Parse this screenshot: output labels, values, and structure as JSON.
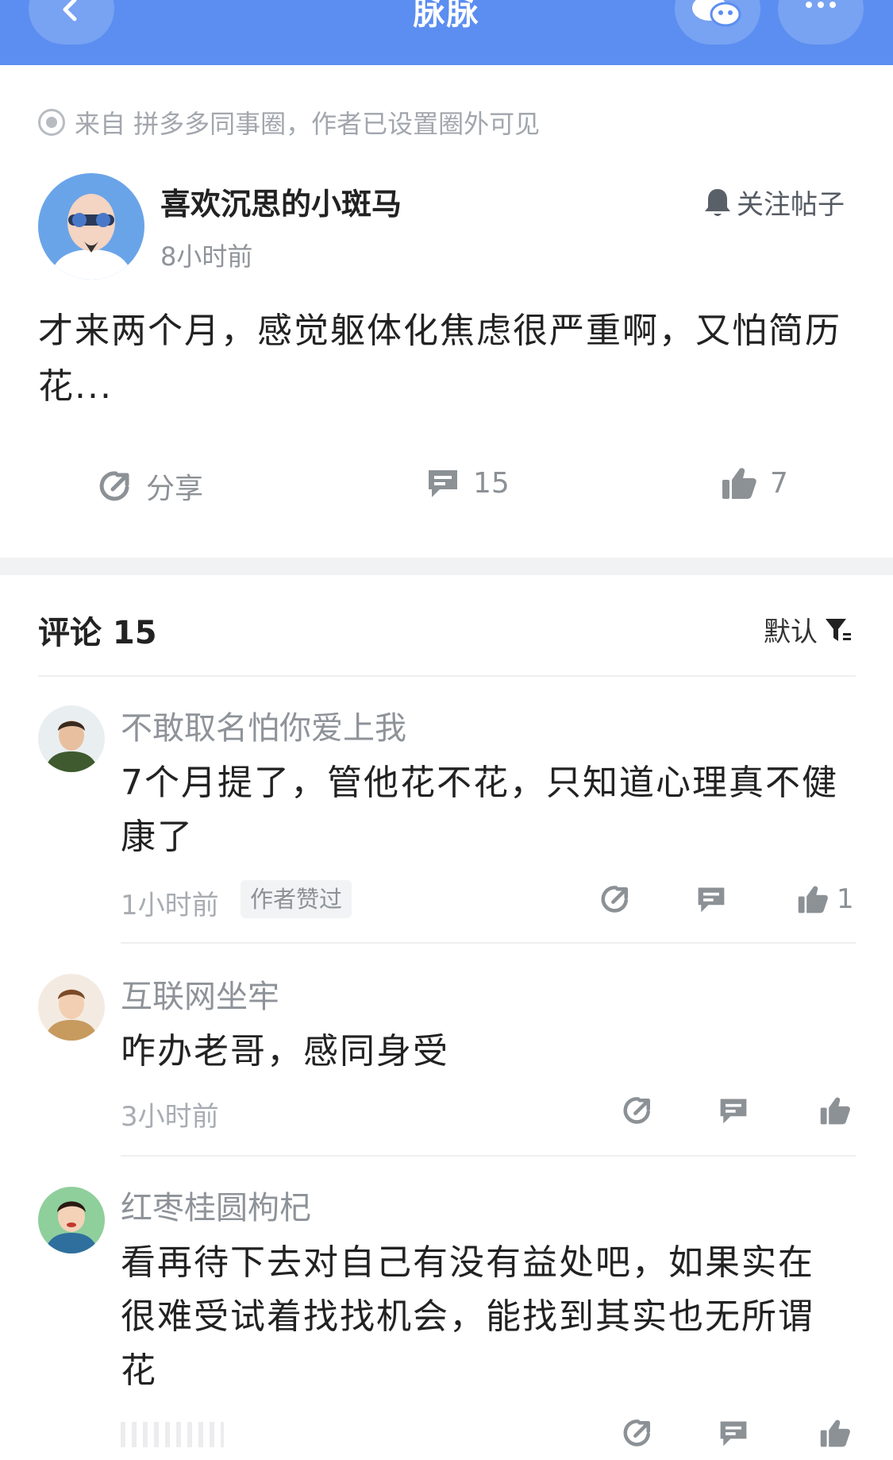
{
  "app": {
    "title": "脉脉"
  },
  "post": {
    "origin": "来自 拼多多同事圈，作者已设置圈外可见",
    "author": "喜欢沉思的小斑马",
    "time": "8小时前",
    "follow_label": "关注帖子",
    "text": "才来两个月，感觉躯体化焦虑很严重啊，又怕简历花...",
    "share_label": "分享",
    "comment_count": "15",
    "like_count": "7"
  },
  "comments_section": {
    "title": "评论 15",
    "sort_label": "默认"
  },
  "comments": [
    {
      "name": "不敢取名怕你爱上我",
      "text": "7个月提了，管他花不花，只知道心理真不健康了",
      "time": "1小时前",
      "badge": "作者赞过",
      "likes": "1"
    },
    {
      "name": "互联网坐牢",
      "text": "咋办老哥，感同身受",
      "time": "3小时前",
      "badge": "",
      "likes": ""
    },
    {
      "name": "红枣桂圆枸杞",
      "text": "看再待下去对自己有没有益处吧，如果实在很难受试着找找机会，能找到其实也无所谓花",
      "time": "",
      "badge": "",
      "likes": ""
    }
  ],
  "colors": {
    "brand": "#5b8ef0",
    "icon_gray": "#8c9196"
  },
  "icons": [
    "back-icon",
    "wechat-icon",
    "more-icon",
    "origin-icon",
    "bell-icon",
    "share-icon",
    "comment-icon",
    "like-icon",
    "filter-icon"
  ]
}
